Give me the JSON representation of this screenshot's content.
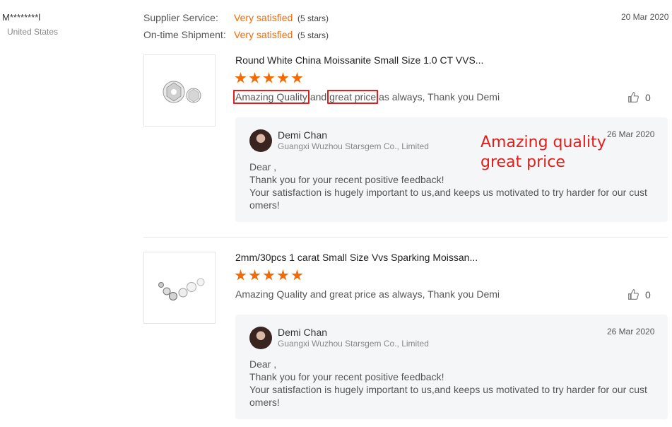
{
  "buyer": {
    "name": "M********l",
    "country": "United States"
  },
  "ratings": [
    {
      "label": "Supplier Service:",
      "value": "Very satisfied",
      "stars_text": "(5 stars)",
      "stars": 5
    },
    {
      "label": "On-time Shipment:",
      "value": "Very satisfied",
      "stars_text": "(5 stars)",
      "stars": 5
    }
  ],
  "feedback_date": "20 Mar 2020",
  "reviews": [
    {
      "product_title": "Round White China Moissanite Small Size 1.0 CT VVS...",
      "stars": 5,
      "text_part1": "Amazing Quality",
      "text_part2": " and ",
      "text_part3": "great price",
      "text_part4": " as always, Thank you Demi",
      "likes": "0",
      "reply": {
        "name": "Demi Chan",
        "company": "Guangxi Wuzhou Starsgem Co., Limited",
        "date": "26 Mar 2020",
        "line1": "Dear ,",
        "line2": "Thank you for your recent positive feedback!",
        "line3": "Your satisfaction is hugely important to us,and keeps us motivated to try harder for our customers!"
      }
    },
    {
      "product_title": "2mm/30pcs 1 carat Small Size Vvs Sparking Moissan...",
      "stars": 5,
      "text": "Amazing Quality and great price as always, Thank you Demi",
      "likes": "0",
      "reply": {
        "name": "Demi Chan",
        "company": "Guangxi Wuzhou Starsgem Co., Limited",
        "date": "26 Mar 2020",
        "line1": "Dear ,",
        "line2": "Thank you for your recent positive feedback!",
        "line3": "Your satisfaction is hugely important to us,and keeps us motivated to try harder for our customers!"
      }
    }
  ],
  "annotation": {
    "line1": "Amazing quality",
    "line2": "great price"
  },
  "colors": {
    "accent": "#f56a00",
    "annotation_red": "#e0201b"
  },
  "icons": {
    "like": "thumbs-up-icon",
    "star": "star-icon"
  }
}
